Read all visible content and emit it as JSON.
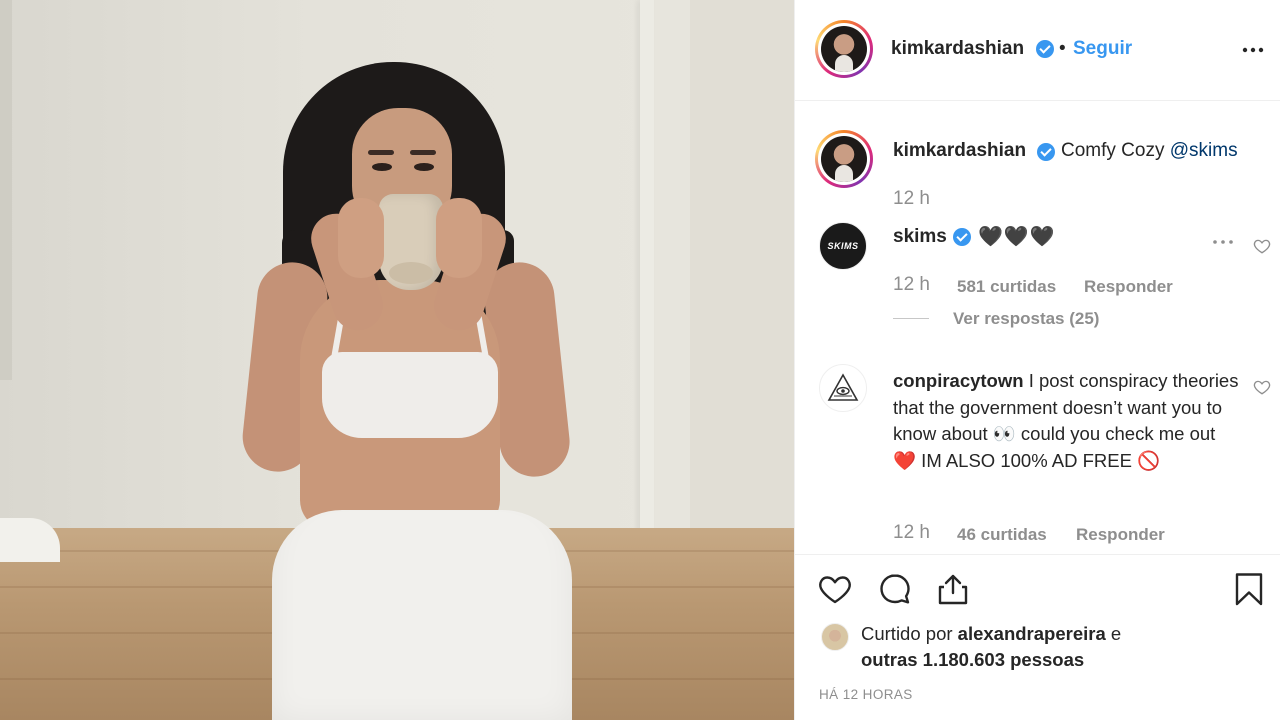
{
  "header": {
    "username": "kimkardashian",
    "separator": "•",
    "follow_label": "Seguir"
  },
  "caption": {
    "username": "kimkardashian",
    "text": "Comfy Cozy ",
    "mention": "@skims",
    "time": "12 h"
  },
  "comments": [
    {
      "username": "skims",
      "avatar_text": "SKIMS",
      "text": "🖤🖤🖤",
      "time": "12 h",
      "likes": "581 curtidas",
      "reply_label": "Responder",
      "view_replies": "Ver respostas (25)"
    },
    {
      "username": "conpiracytown",
      "text": " I post conspiracy theories that the government doesn’t want you to know about 👀 could you check me out ❤️ IM ALSO 100% AD FREE 🚫",
      "time": "12 h",
      "likes": "46 curtidas",
      "reply_label": "Responder"
    }
  ],
  "likes_summary": {
    "prefix": "Curtido por ",
    "liker": "alexandrapereira",
    "conjunction": " e",
    "others": "outras 1.180.603 pessoas"
  },
  "post_time": "HÁ 12 HORAS",
  "colors": {
    "accent": "#3897f0",
    "text": "#262626",
    "muted": "#8e8e8e",
    "mention": "#00376b"
  },
  "icons": [
    "more-icon",
    "verified-badge-icon",
    "heart-icon",
    "comment-icon",
    "share-icon",
    "bookmark-icon",
    "all-seeing-eye-icon"
  ]
}
